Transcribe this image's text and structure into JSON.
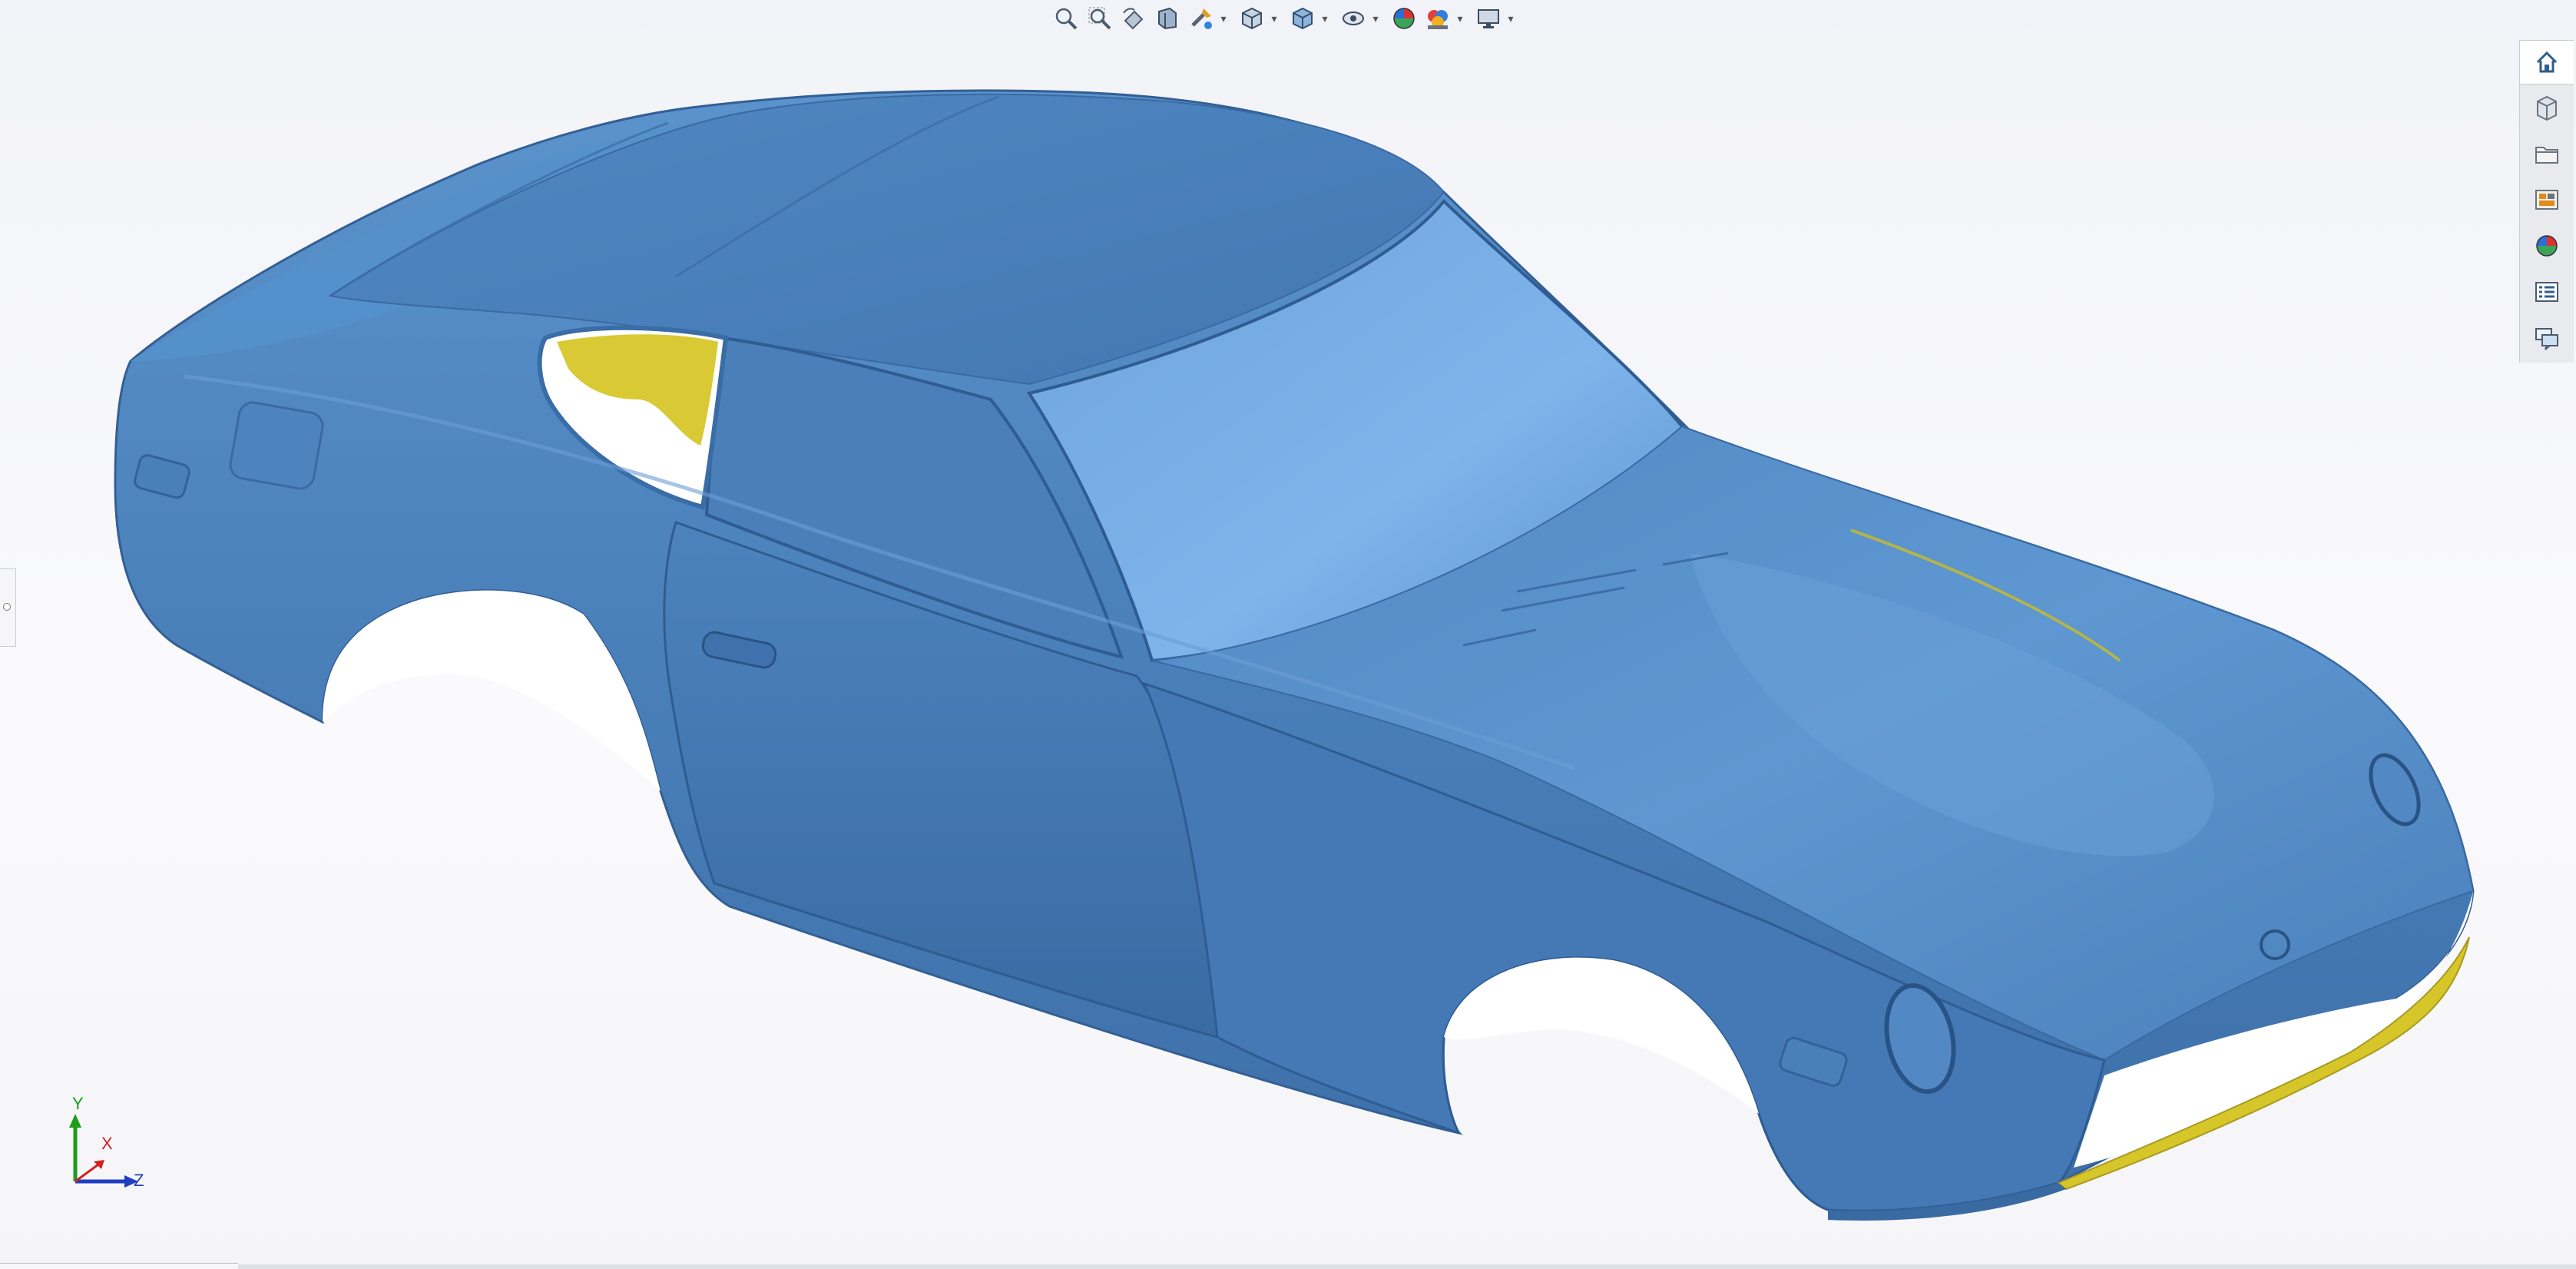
{
  "toolbar": {
    "items": [
      {
        "icon": "zoom-to-fit-icon"
      },
      {
        "icon": "zoom-to-area-icon"
      },
      {
        "icon": "previous-view-icon"
      },
      {
        "icon": "section-view-icon"
      },
      {
        "icon": "view-tools-icon",
        "dropdown": true
      },
      {
        "icon": "display-style-icon",
        "dropdown": true
      },
      {
        "icon": "view-orientation-icon",
        "dropdown": true
      },
      {
        "icon": "hide-show-items-icon",
        "dropdown": true
      },
      {
        "icon": "edit-appearance-icon"
      },
      {
        "icon": "apply-scene-icon",
        "dropdown": true
      },
      {
        "icon": "view-settings-icon",
        "dropdown": true
      }
    ]
  },
  "task_pane": {
    "tabs": [
      {
        "icon": "home-icon",
        "active": true
      },
      {
        "icon": "3d-content-icon"
      },
      {
        "icon": "file-explorer-icon"
      },
      {
        "icon": "view-palette-icon"
      },
      {
        "icon": "appearances-icon"
      },
      {
        "icon": "custom-properties-icon"
      },
      {
        "icon": "forum-icon"
      }
    ]
  },
  "triad": {
    "y_label": "Y",
    "x_label": "X",
    "z_label": "Z"
  },
  "colors": {
    "body": "#4f86c0",
    "body_dark": "#3a6ca6",
    "body_light": "#7fb0e0",
    "glass_highlight": "#8fc2f0",
    "interior": "#d7c62a",
    "axis_y": "#1a9e1a",
    "axis_x": "#d42020",
    "axis_z": "#1f3fc0"
  }
}
